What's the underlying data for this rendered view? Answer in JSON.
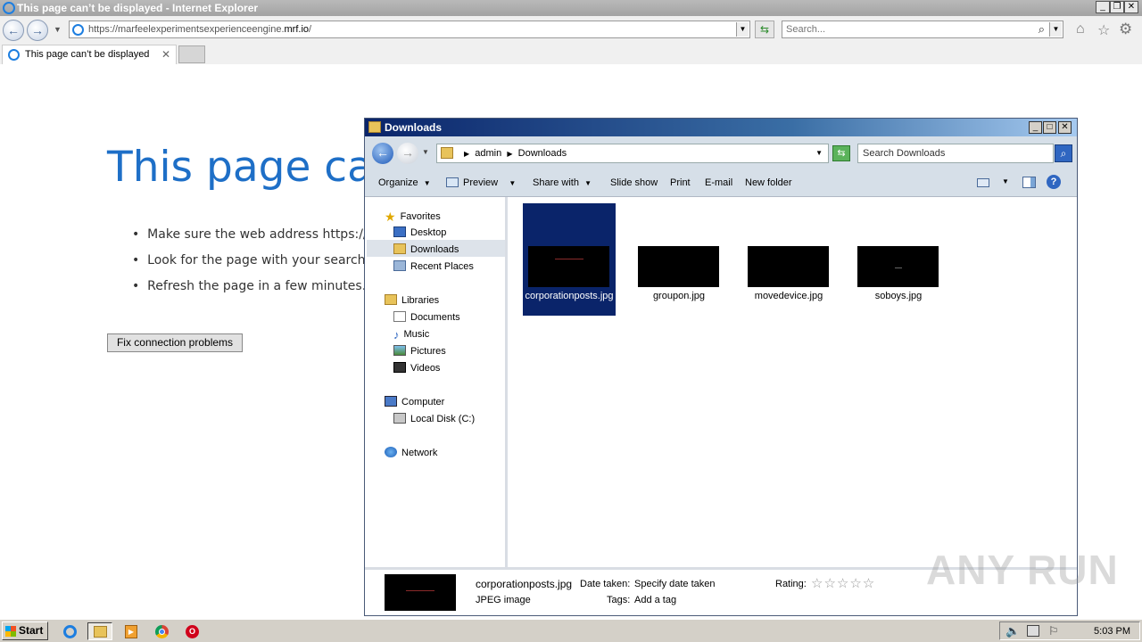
{
  "ie": {
    "window_title": "This page can’t be displayed - Internet Explorer",
    "url_prefix": "https://marfeelexperimentsexperienceengine.",
    "url_domain": "mrf.io",
    "url_suffix": "/",
    "search_placeholder": "Search...",
    "tab_label": "This page can’t be displayed"
  },
  "page": {
    "heading": "This page can",
    "bullets": [
      "Make sure the web address https://m",
      "Look for the page with your search er",
      "Refresh the page in a few minutes."
    ],
    "fix_button": "Fix connection problems"
  },
  "explorer": {
    "title": "Downloads",
    "breadcrumb": [
      "admin",
      "Downloads"
    ],
    "search_placeholder": "Search Downloads",
    "commands": [
      "Organize",
      "Preview",
      "Share with",
      "Slide show",
      "Print",
      "E-mail",
      "New folder"
    ],
    "nav": {
      "favorites_label": "Favorites",
      "favorites": [
        "Desktop",
        "Downloads",
        "Recent Places"
      ],
      "libraries_label": "Libraries",
      "libraries": [
        "Documents",
        "Music",
        "Pictures",
        "Videos"
      ],
      "computer_label": "Computer",
      "computer": [
        "Local Disk (C:)"
      ],
      "network_label": "Network"
    },
    "files": [
      {
        "name": "corporationposts.jpg",
        "selected": true
      },
      {
        "name": "groupon.jpg",
        "selected": false
      },
      {
        "name": "movedevice.jpg",
        "selected": false
      },
      {
        "name": "soboys.jpg",
        "selected": false
      }
    ],
    "details": {
      "filename": "corporationposts.jpg",
      "type": "JPEG image",
      "date_label": "Date taken:",
      "date_value": "Specify date taken",
      "tags_label": "Tags:",
      "tags_value": "Add a tag",
      "rating_label": "Rating:"
    }
  },
  "watermark": "ANY RUN",
  "taskbar": {
    "start_label": "Start",
    "clock": "5:03 PM"
  },
  "colors": {
    "selection": "#0a246a",
    "heading_blue": "#1e6fc7"
  }
}
